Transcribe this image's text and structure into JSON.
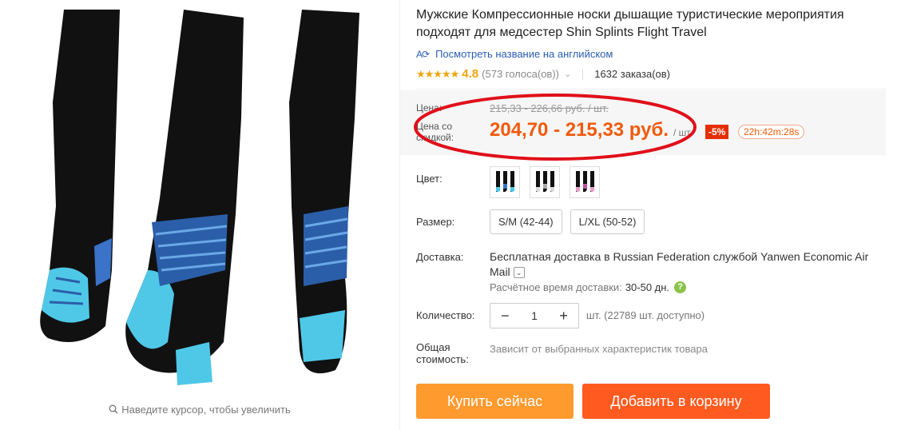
{
  "gallery": {
    "zoom_hint": "Наведите курсор, чтобы увеличить",
    "zoom_icon": "magnifier-icon"
  },
  "product": {
    "title": "Мужские Компрессионные носки дышащие туристические мероприятия подходят для медсестер Shin Splints Flight Travel",
    "translate_icon": "translate-icon",
    "translate_link": "Посмотреть название на английском"
  },
  "rating": {
    "stars": "★★★★★",
    "score": "4.8",
    "votes": "(573 голоса(ов))",
    "orders": "1632 заказа(ов)"
  },
  "price": {
    "label": "Цена:",
    "original": "215,33 - 226,66 руб. / шт.",
    "discount_label": "Цена со скидкой:",
    "discounted": "204,70 - 215,33 руб.",
    "per_unit": "/ шт.",
    "discount_badge": "-5%",
    "timer": "22h:42m:28s"
  },
  "color": {
    "label": "Цвет:"
  },
  "size": {
    "label": "Размер:",
    "options": [
      "S/M (42-44)",
      "L/XL (50-52)"
    ]
  },
  "delivery": {
    "label": "Доставка:",
    "text": "Бесплатная доставка в Russian Federation службой Yanwen Economic Air Mail",
    "eta_label": "Расчётное время доставки:",
    "eta_value": "30-50 дн.",
    "help": "?"
  },
  "quantity": {
    "label": "Количество:",
    "minus": "−",
    "value": "1",
    "plus": "+",
    "available": "шт. (22789 шт. доступно)"
  },
  "total": {
    "label": "Общая стоимость:",
    "value": "Зависит от выбранных характеристик товара"
  },
  "buttons": {
    "buy": "Купить сейчас",
    "cart": "Добавить в корзину"
  },
  "colors": {
    "accent": "#f05a0a",
    "buy": "#ff9a2f",
    "cart": "#ff5a1f",
    "star": "#f0a40f",
    "link": "#2a5db0",
    "highlight": "#e0101a"
  }
}
